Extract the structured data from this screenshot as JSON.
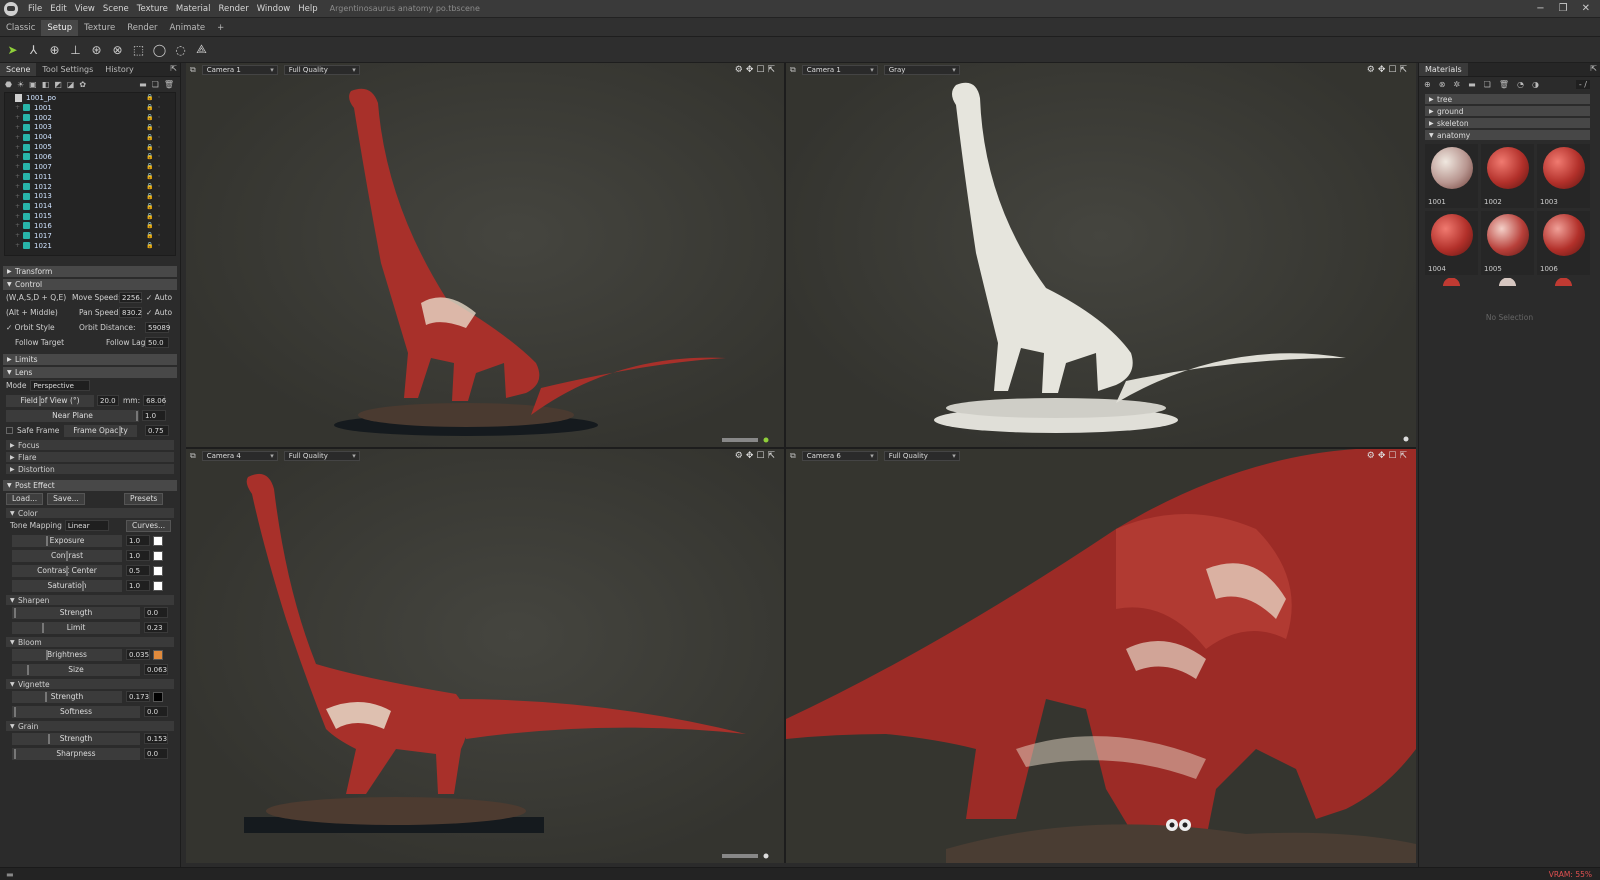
{
  "menubar": {
    "items": [
      "File",
      "Edit",
      "View",
      "Scene",
      "Texture",
      "Material",
      "Render",
      "Window",
      "Help"
    ],
    "doc_title": "Argentinosaurus anatomy po.tbscene"
  },
  "workspace_tabs": [
    "Classic",
    "Setup",
    "Texture",
    "Render",
    "Animate",
    "+"
  ],
  "left_panel": {
    "tabs": [
      "Scene",
      "Tool Settings",
      "History"
    ],
    "tree": {
      "root": "1001_po",
      "items": [
        "1001",
        "1002",
        "1003",
        "1004",
        "1005",
        "1006",
        "1007",
        "1011",
        "1012",
        "1013",
        "1014",
        "1015",
        "1016",
        "1017",
        "1021"
      ]
    },
    "sections": {
      "transform": "Transform",
      "control": "Control",
      "limits": "Limits",
      "lens": "Lens",
      "focus": "Focus",
      "flare": "Flare",
      "distortion": "Distortion",
      "post_effect": "Post Effect",
      "color": "Color",
      "sharpen": "Sharpen",
      "bloom": "Bloom",
      "vignette": "Vignette",
      "grain": "Grain"
    },
    "control": {
      "wasd": "(W,A,S,D + Q,E)",
      "move_speed_label": "Move Speed:",
      "move_speed": "2256.",
      "auto1": "✓ Auto",
      "alt_middle": "(Alt + Middle)",
      "pan_speed_label": "Pan Speed:",
      "pan_speed": "830.2",
      "auto2": "✓ Auto",
      "orbit_style": "✓ Orbit Style",
      "orbit_distance_label": "Orbit Distance:",
      "orbit_distance": "59089",
      "follow_target": "Follow Target",
      "follow_lag_label": "Follow Lag",
      "follow_lag": "50.0"
    },
    "lens": {
      "mode_label": "Mode",
      "mode": "Perspective",
      "fov_label": "Field of View (°)",
      "fov": "20.0",
      "mm_label": "mm:",
      "mm": "68.06",
      "near_plane_label": "Near Plane",
      "near_plane": "1.0",
      "safe_frame": "Safe Frame",
      "frame_opacity_label": "Frame Opacity",
      "frame_opacity": "0.75"
    },
    "post": {
      "load": "Load...",
      "save": "Save...",
      "presets": "Presets",
      "tone_mapping_label": "Tone Mapping",
      "tone_mapping": "Linear",
      "curves": "Curves...",
      "exposure_label": "Exposure",
      "exposure": "1.0",
      "contrast_label": "Contrast",
      "contrast": "1.0",
      "contrast_center_label": "Contrast Center",
      "contrast_center": "0.5",
      "saturation_label": "Saturation",
      "saturation": "1.0",
      "sharpen_strength_label": "Strength",
      "sharpen_strength": "0.0",
      "sharpen_limit_label": "Limit",
      "sharpen_limit": "0.23",
      "bloom_brightness_label": "Brightness",
      "bloom_brightness": "0.035",
      "bloom_size_label": "Size",
      "bloom_size": "0.063",
      "vignette_strength_label": "Strength",
      "vignette_strength": "0.173",
      "vignette_softness_label": "Softness",
      "vignette_softness": "0.0",
      "grain_strength_label": "Strength",
      "grain_strength": "0.153",
      "grain_sharpness_label": "Sharpness",
      "grain_sharpness": "0.0"
    }
  },
  "viewports": [
    {
      "camera": "Camera 1",
      "mode": "Full Quality"
    },
    {
      "camera": "Camera 1",
      "mode": "Gray"
    },
    {
      "camera": "Camera 4",
      "mode": "Full Quality"
    },
    {
      "camera": "Camera 6",
      "mode": "Full Quality"
    }
  ],
  "right_panel": {
    "tab": "Materials",
    "search": "- /",
    "categories": [
      "tree",
      "ground",
      "skeleton",
      "anatomy"
    ],
    "materials": [
      "1001",
      "1002",
      "1003",
      "1004",
      "1005",
      "1006"
    ],
    "no_selection": "No Selection"
  },
  "status": {
    "vram": "VRAM: 55%"
  },
  "colors": {
    "muscle": "#a8302a",
    "accent": "#8fcf3a",
    "vram": "#e05050"
  }
}
